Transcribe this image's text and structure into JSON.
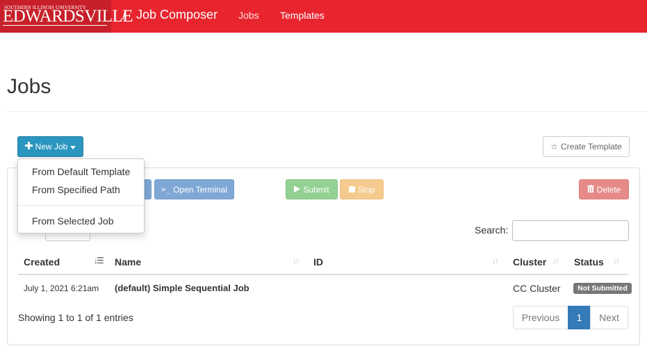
{
  "navbar": {
    "logo_top": "SOUTHERN ILLINOIS UNIVERSITY",
    "logo_main": "EDWARDSVILLE",
    "separator": "/",
    "brand": "Job Composer",
    "links": [
      "Jobs",
      "Templates"
    ]
  },
  "page": {
    "title": "Jobs"
  },
  "toolbar": {
    "new_job": "New Job",
    "create_template": "Create Template",
    "open_terminal": "Open Terminal",
    "submit": "Submit",
    "stop": "Stop",
    "delete": "Delete"
  },
  "dropdown": {
    "items": [
      "From Default Template",
      "From Specified Path",
      "From Selected Job"
    ]
  },
  "search": {
    "label": "Search:",
    "value": ""
  },
  "table": {
    "columns": [
      "Created",
      "Name",
      "ID",
      "Cluster",
      "Status"
    ],
    "rows": [
      {
        "created": "July 1, 2021 6:21am",
        "name": "(default) Simple Sequential Job",
        "id": "",
        "cluster": "CC Cluster",
        "status": "Not Submitted"
      }
    ],
    "info": "Showing 1 to 1 of 1 entries"
  },
  "pagination": {
    "previous": "Previous",
    "current": "1",
    "next": "Next"
  },
  "colors": {
    "navbar": "#e8242e",
    "primary": "#2a95bf",
    "pagination_active": "#337ab7",
    "badge": "#777777"
  }
}
